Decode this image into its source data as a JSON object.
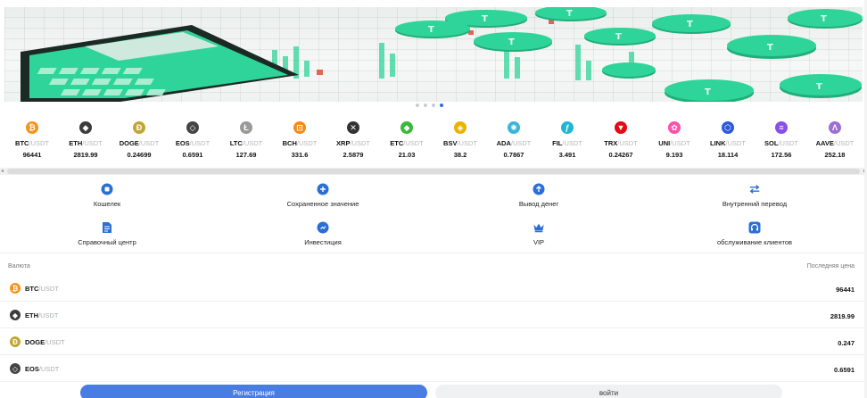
{
  "banner": {
    "dots": 4,
    "active_dot": 3,
    "accent_color": "#2fd49a"
  },
  "tickers": [
    {
      "base": "BTC",
      "quote": "/USDT",
      "price": "96441",
      "icon": "bitcoin-icon",
      "color": "#f7931a",
      "glyph": "₿"
    },
    {
      "base": "ETH",
      "quote": "/USDT",
      "price": "2819.99",
      "icon": "ethereum-icon",
      "color": "#3c3c3d",
      "glyph": "◆"
    },
    {
      "base": "DOGE",
      "quote": "/USDT",
      "price": "0.24699",
      "icon": "dogecoin-icon",
      "color": "#c2a633",
      "glyph": "Ð"
    },
    {
      "base": "EOS",
      "quote": "/USDT",
      "price": "0.6591",
      "icon": "eos-icon",
      "color": "#444444",
      "glyph": "◇"
    },
    {
      "base": "LTC",
      "quote": "/USDT",
      "price": "127.69",
      "icon": "litecoin-icon",
      "color": "#9a9a9a",
      "glyph": "Ł"
    },
    {
      "base": "BCH",
      "quote": "/USDT",
      "price": "331.6",
      "icon": "bitcoin-cash-icon",
      "color": "#f08c1a",
      "glyph": "⊡"
    },
    {
      "base": "XRP",
      "quote": "/USDT",
      "price": "2.5879",
      "icon": "xrp-icon",
      "color": "#333333",
      "glyph": "✕"
    },
    {
      "base": "ETC",
      "quote": "/USDT",
      "price": "21.03",
      "icon": "ethereum-classic-icon",
      "color": "#3ab83a",
      "glyph": "◆"
    },
    {
      "base": "BSV",
      "quote": "/USDT",
      "price": "38.2",
      "icon": "bitcoin-sv-icon",
      "color": "#eab300",
      "glyph": "◈"
    },
    {
      "base": "ADA",
      "quote": "/USDT",
      "price": "0.7867",
      "icon": "cardano-icon",
      "color": "#37b6d6",
      "glyph": "✺"
    },
    {
      "base": "FIL",
      "quote": "/USDT",
      "price": "3.491",
      "icon": "filecoin-icon",
      "color": "#1fb6d6",
      "glyph": "ƒ"
    },
    {
      "base": "TRX",
      "quote": "/USDT",
      "price": "0.24267",
      "icon": "tron-icon",
      "color": "#e50914",
      "glyph": "▼"
    },
    {
      "base": "UNI",
      "quote": "/USDT",
      "price": "9.193",
      "icon": "uniswap-icon",
      "color": "#ff4fa8",
      "glyph": "✿"
    },
    {
      "base": "LINK",
      "quote": "/USDT",
      "price": "18.114",
      "icon": "chainlink-icon",
      "color": "#2a5ada",
      "glyph": "⬡"
    },
    {
      "base": "SOL",
      "quote": "/USDT",
      "price": "172.56",
      "icon": "solana-icon",
      "color": "#8a4fe8",
      "glyph": "≡"
    },
    {
      "base": "AAVE",
      "quote": "/USDT",
      "price": "252.18",
      "icon": "aave-icon",
      "color": "#9c6fd0",
      "glyph": "Λ"
    }
  ],
  "menu": {
    "wallet": "Кошелек",
    "saved_value": "Сохраненное значение",
    "withdraw": "Вывод денег",
    "internal_transfer": "Внутренний перевод",
    "help_center": "Справочный центр",
    "investment": "Инвестиция",
    "vip": "VIP",
    "customer_service": "обслуживание клиентов"
  },
  "market": {
    "col_currency": "Валюта",
    "col_last_price": "Последняя цена",
    "rows": [
      {
        "base": "BTC",
        "quote": "/USDT",
        "price": "96441"
      },
      {
        "base": "ETH",
        "quote": "/USDT",
        "price": "2819.99"
      },
      {
        "base": "DOGE",
        "quote": "/USDT",
        "price": "0.247"
      },
      {
        "base": "EOS",
        "quote": "/USDT",
        "price": "0.6591"
      }
    ]
  },
  "auth": {
    "register": "Регистрация",
    "login": "войти"
  },
  "colors": {
    "primary": "#4a7de2",
    "menu_icon": "#2b6fd6"
  }
}
